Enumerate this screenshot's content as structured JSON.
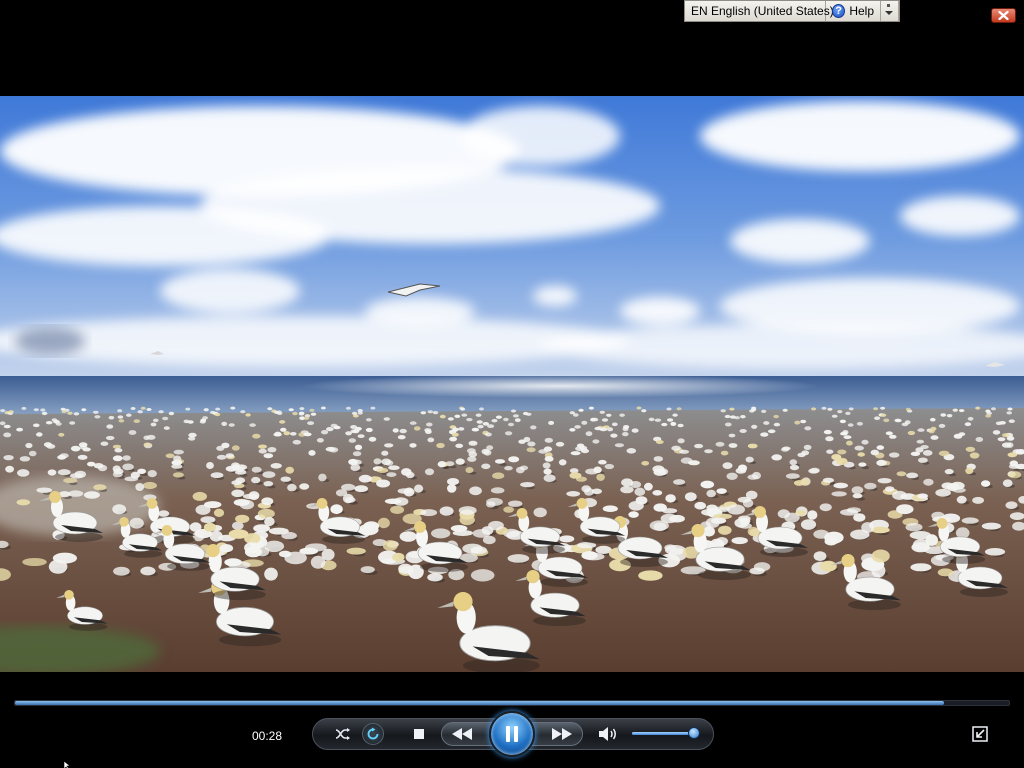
{
  "language_bar": {
    "language": "EN English (United States)",
    "help_label": "Help",
    "help_icon": "help-icon",
    "options_icon": "chevron-down-icon"
  },
  "window": {
    "close_icon": "close-icon"
  },
  "player": {
    "elapsed_time": "00:28",
    "seek_progress": 0.935,
    "volume_level": 0.93,
    "state": "playing"
  },
  "controls": {
    "shuffle_icon": "shuffle-icon",
    "repeat_icon": "repeat-icon",
    "stop_icon": "stop-icon",
    "previous_icon": "previous-icon",
    "play_pause_icon": "pause-icon",
    "next_icon": "next-icon",
    "mute_icon": "speaker-icon",
    "switch_mode_icon": "switch-to-library-icon"
  },
  "colors": {
    "accent": "#3da2ff",
    "close_red": "#c43b1f",
    "background": "#000000"
  }
}
